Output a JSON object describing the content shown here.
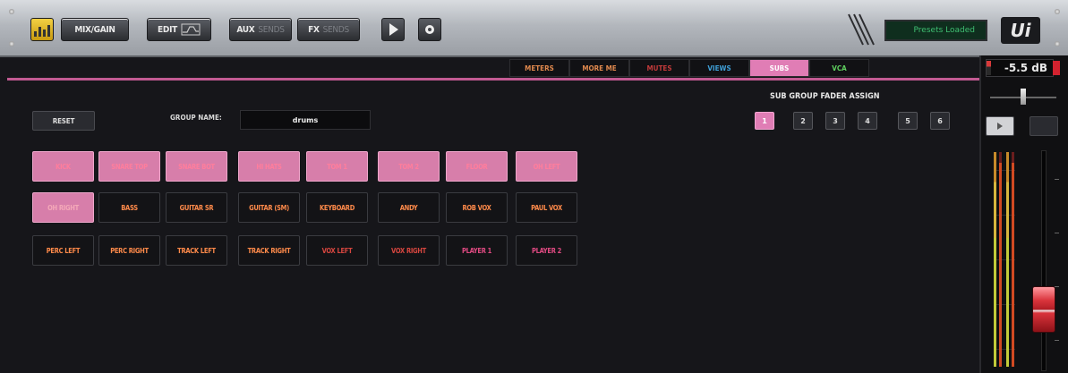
{
  "toolbar": {
    "mix_gain_label": "MIX/GAIN",
    "edit_label": "EDIT",
    "aux_label": "AUX",
    "aux_slot": "SENDS",
    "fx_label": "FX",
    "fx_slot": "SENDS",
    "lcd_text": "Presets Loaded",
    "logo_text": "Ui"
  },
  "tabs": [
    {
      "label": "METERS",
      "color": "#e0894e"
    },
    {
      "label": "MORE ME",
      "color": "#e0894e"
    },
    {
      "label": "MUTES",
      "color": "#c23a3a"
    },
    {
      "label": "VIEWS",
      "color": "#3fa0d8"
    },
    {
      "label": "SUBS",
      "color": "#ffffff"
    },
    {
      "label": "VCA",
      "color": "#5fd05f"
    }
  ],
  "reset_label": "RESET",
  "group_name_label": "GROUP NAME:",
  "group_name_value": "drums",
  "sub_group": {
    "title": "SUB GROUP FADER ASSIGN",
    "buttons": [
      "1",
      "2",
      "3",
      "4",
      "5",
      "6"
    ]
  },
  "channels": {
    "row1": [
      "KICK",
      "SNARE TOP",
      "SNARE BOT",
      "HI HATS",
      "TOM 1",
      "TOM 2",
      "FLOOR",
      "OH LEFT"
    ],
    "row2": [
      "OH RIGHT",
      "BASS",
      "GUITAR SR",
      "GUITAR (SM)",
      "KEYBOARD",
      "ANDY",
      "ROB VOX",
      "PAUL VOX"
    ],
    "row3": [
      "PERC LEFT",
      "PERC RIGHT",
      "TRACK LEFT",
      "TRACK RIGHT",
      "VOX LEFT",
      "VOX RIGHT",
      "PLAYER 1",
      "PLAYER 2"
    ]
  },
  "strip": {
    "gain_display": "-5.5 dB"
  },
  "colors": {
    "accent_pink": "#e07db5",
    "active_channel_text": "#ff7d9c",
    "inactive_channel_text": "#ff8a4a"
  }
}
